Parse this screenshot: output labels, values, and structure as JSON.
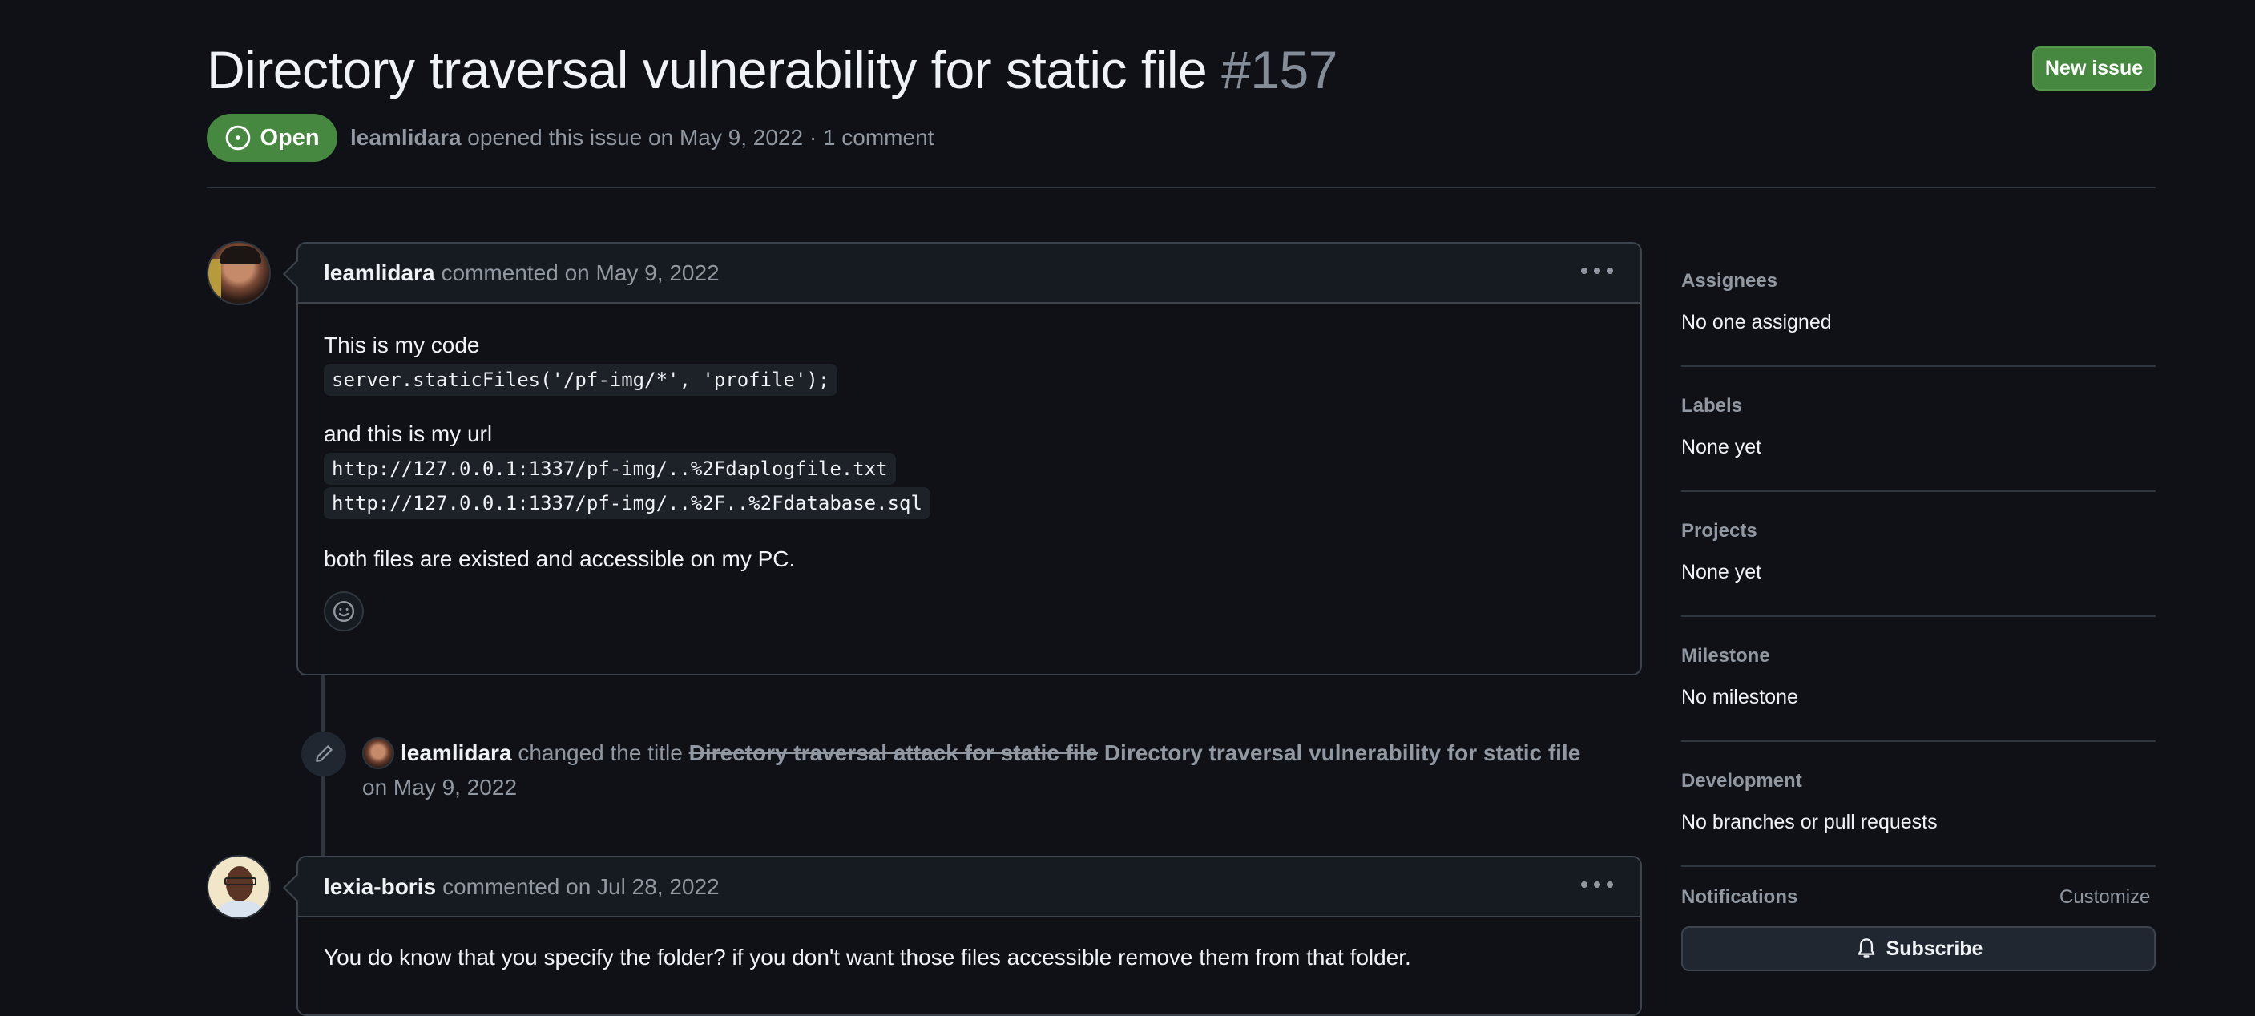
{
  "header": {
    "title": "Directory traversal vulnerability for static file",
    "number": "#157",
    "new_issue_label": "New issue",
    "state_label": "Open",
    "author": "leamlidara",
    "meta_text": " opened this issue on May 9, 2022 · 1 comment"
  },
  "colors": {
    "open_green": "#46883f",
    "background": "#0f1117",
    "muted_text": "#9198a1"
  },
  "comments": [
    {
      "author": "leamlidara",
      "meta": "commented on May 9, 2022",
      "body": {
        "p1": "This is my code",
        "code1": "server.staticFiles('/pf-img/*', 'profile');",
        "p2": "and this is my url",
        "code2": "http://127.0.0.1:1337/pf-img/..%2Fdaplogfile.txt",
        "code3": "http://127.0.0.1:1337/pf-img/..%2F..%2Fdatabase.sql",
        "p3": "both files are existed and accessible on my PC."
      }
    },
    {
      "author": "lexia-boris",
      "meta": "commented on Jul 28, 2022",
      "body": {
        "p1": "You do know that you specify the folder? if you don't want those files accessible remove them from that folder."
      }
    }
  ],
  "event": {
    "actor": "leamlidara",
    "action": "changed the title",
    "old_title": "Directory traversal attack for static file",
    "new_title": "Directory traversal vulnerability for static file",
    "date": "on May 9, 2022"
  },
  "sidebar": {
    "sections": [
      {
        "heading": "Assignees",
        "value": "No one assigned"
      },
      {
        "heading": "Labels",
        "value": "None yet"
      },
      {
        "heading": "Projects",
        "value": "None yet"
      },
      {
        "heading": "Milestone",
        "value": "No milestone"
      },
      {
        "heading": "Development",
        "value": "No branches or pull requests"
      }
    ],
    "notifications": {
      "heading": "Notifications",
      "customize_label": "Customize",
      "subscribe_label": "Subscribe"
    }
  }
}
